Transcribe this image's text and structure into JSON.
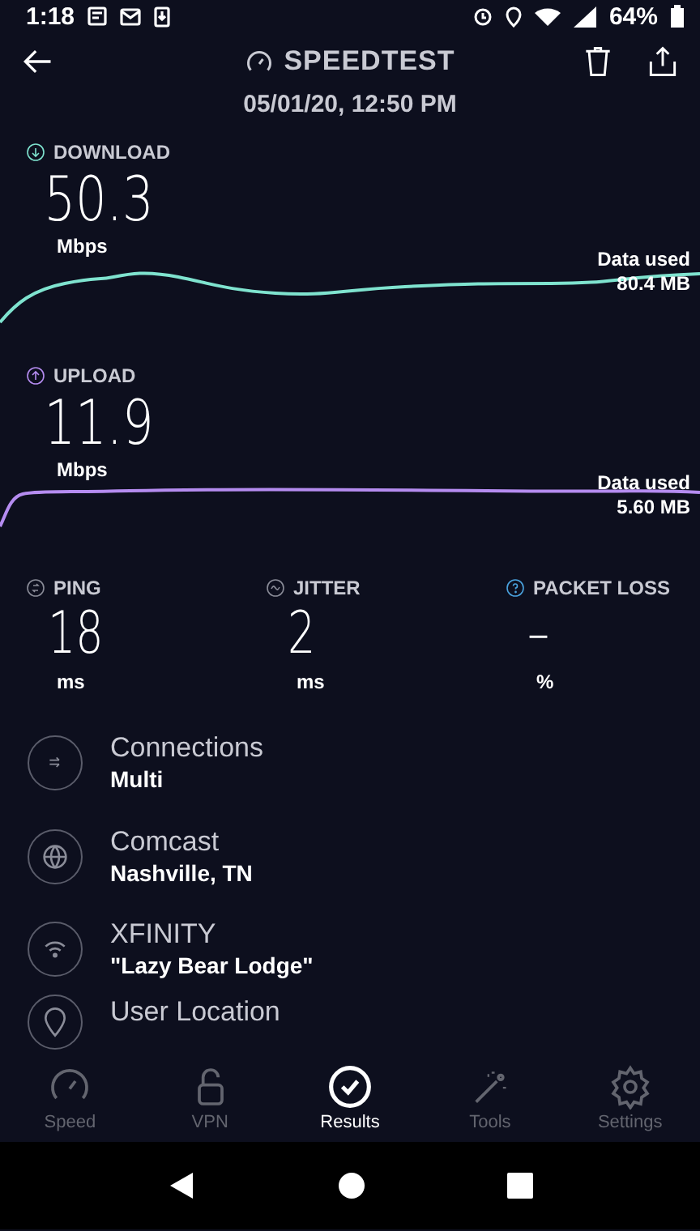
{
  "status_bar": {
    "time": "1:18",
    "battery": "64%"
  },
  "header": {
    "title": "SPEEDTEST",
    "date": "05/01/20, 12:50 PM"
  },
  "results": [
    {
      "kind": "download",
      "label": "DOWNLOAD",
      "value": "50.3",
      "unit": "Mbps",
      "data_label": "Data used",
      "data_value": "80.4 MB",
      "color": "#7fe3cf"
    },
    {
      "kind": "upload",
      "label": "UPLOAD",
      "value": "11.9",
      "unit": "Mbps",
      "data_label": "Data used",
      "data_value": "5.60 MB",
      "color": "#b58cf0"
    }
  ],
  "metrics": [
    {
      "kind": "ping",
      "label": "PING",
      "value": "18",
      "unit": "ms"
    },
    {
      "kind": "jitter",
      "label": "JITTER",
      "value": "2",
      "unit": "ms"
    },
    {
      "kind": "packet_loss",
      "label": "PACKET LOSS",
      "value": "–",
      "unit": "%"
    }
  ],
  "details": [
    {
      "kind": "connections",
      "title": "Connections",
      "value": "Multi"
    },
    {
      "kind": "server",
      "title": "Comcast",
      "value": "Nashville, TN"
    },
    {
      "kind": "wifi",
      "title": "XFINITY",
      "value": "\"Lazy Bear Lodge\""
    },
    {
      "kind": "location",
      "title": "User Location"
    }
  ],
  "nav": [
    {
      "kind": "speed",
      "label": "Speed",
      "selected": false
    },
    {
      "kind": "vpn",
      "label": "VPN",
      "selected": false
    },
    {
      "kind": "results",
      "label": "Results",
      "selected": true
    },
    {
      "kind": "tools",
      "label": "Tools",
      "selected": false
    },
    {
      "kind": "settings",
      "label": "Settings",
      "selected": false
    }
  ]
}
